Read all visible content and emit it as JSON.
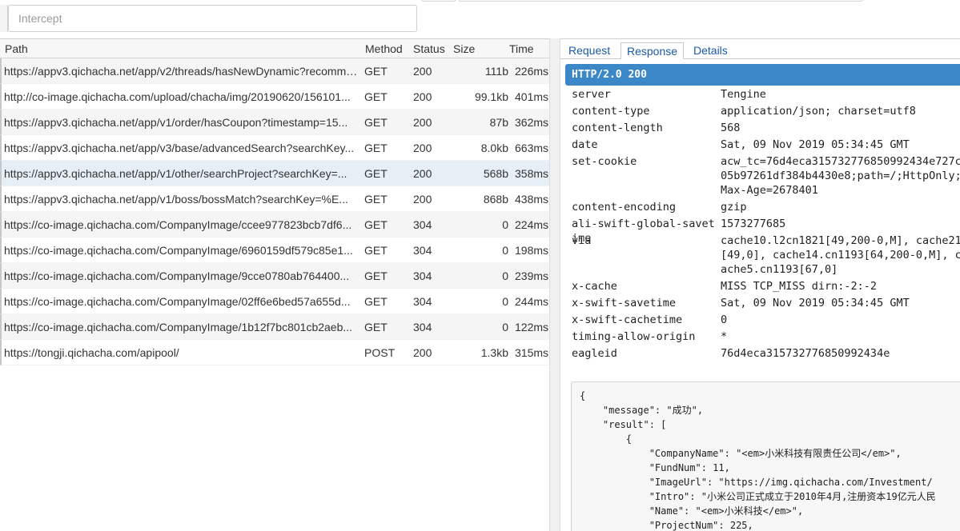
{
  "search": {
    "placeholder": "Intercept"
  },
  "table": {
    "headers": {
      "path": "Path",
      "method": "Method",
      "status": "Status",
      "size": "Size",
      "time": "Time"
    },
    "rows": [
      {
        "path": "https://appv3.qichacha.net/app/v2/threads/hasNewDynamic?recommend...",
        "method": "GET",
        "status": "200",
        "size": "111b",
        "time": "226ms"
      },
      {
        "path": "http://co-image.qichacha.com/upload/chacha/img/20190620/156101...",
        "method": "GET",
        "status": "200",
        "size": "99.1kb",
        "time": "401ms"
      },
      {
        "path": "https://appv3.qichacha.net/app/v1/order/hasCoupon?timestamp=15...",
        "method": "GET",
        "status": "200",
        "size": "87b",
        "time": "362ms"
      },
      {
        "path": "https://appv3.qichacha.net/app/v3/base/advancedSearch?searchKey...",
        "method": "GET",
        "status": "200",
        "size": "8.0kb",
        "time": "663ms"
      },
      {
        "path": "https://appv3.qichacha.net/app/v1/other/searchProject?searchKey=...",
        "method": "GET",
        "status": "200",
        "size": "568b",
        "time": "358ms"
      },
      {
        "path": "https://appv3.qichacha.net/app/v1/boss/bossMatch?searchKey=%E...",
        "method": "GET",
        "status": "200",
        "size": "868b",
        "time": "438ms"
      },
      {
        "path": "https://co-image.qichacha.com/CompanyImage/ccee977823bcb7df6...",
        "method": "GET",
        "status": "304",
        "size": "0",
        "time": "224ms"
      },
      {
        "path": "https://co-image.qichacha.com/CompanyImage/6960159df579c85e1...",
        "method": "GET",
        "status": "304",
        "size": "0",
        "time": "198ms"
      },
      {
        "path": "https://co-image.qichacha.com/CompanyImage/9cce0780ab764400...",
        "method": "GET",
        "status": "304",
        "size": "0",
        "time": "239ms"
      },
      {
        "path": "https://co-image.qichacha.com/CompanyImage/02ff6e6bed57a655d...",
        "method": "GET",
        "status": "304",
        "size": "0",
        "time": "244ms"
      },
      {
        "path": "https://co-image.qichacha.com/CompanyImage/1b12f7bc801cb2aeb...",
        "method": "GET",
        "status": "304",
        "size": "0",
        "time": "122ms"
      },
      {
        "path": "https://tongji.qichacha.com/apipool/",
        "method": "POST",
        "status": "200",
        "size": "1.3kb",
        "time": "315ms"
      }
    ],
    "selected_index": 4
  },
  "detail": {
    "tabs": [
      {
        "label": "Request"
      },
      {
        "label": "Response"
      },
      {
        "label": "Details"
      }
    ],
    "active_tab": "Response",
    "status_line": "HTTP/2.0 200",
    "headers": [
      {
        "key": "server",
        "value": "Tengine"
      },
      {
        "key": "content-type",
        "value": "application/json; charset=utf8"
      },
      {
        "key": "content-length",
        "value": "568"
      },
      {
        "key": "date",
        "value": "Sat, 09 Nov 2019 05:34:45 GMT"
      },
      {
        "key": "set-cookie",
        "value": "acw_tc=76d4eca315732776850992434e727c05b97261df384b4430e8;path=/;HttpOnly;Max-Age=2678401"
      },
      {
        "key": "content-encoding",
        "value": "gzip"
      },
      {
        "key": "ali-swift-global-savetime",
        "value": "1573277685"
      },
      {
        "key": "via",
        "value": "cache10.l2cn1821[49,200-0,M], cache21[49,0], cache14.cn1193[64,200-0,M], cache5.cn1193[67,0]"
      },
      {
        "key": "x-cache",
        "value": "MISS TCP_MISS dirn:-2:-2"
      },
      {
        "key": "x-swift-savetime",
        "value": "Sat, 09 Nov 2019 05:34:45 GMT"
      },
      {
        "key": "x-swift-cachetime",
        "value": "0"
      },
      {
        "key": "timing-allow-origin",
        "value": "*"
      },
      {
        "key": "eagleid",
        "value": "76d4eca315732776850992434e"
      }
    ],
    "body": "{\n    \"message\": \"成功\",\n    \"result\": [\n        {\n            \"CompanyName\": \"<em>小米科技有限责任公司</em>\",\n            \"FundNum\": 11,\n            \"ImageUrl\": \"https://img.qichacha.com/Investment/\n            \"Intro\": \"小米公司正式成立于2010年4月,注册资本19亿元人民\n            \"Name\": \"<em>小米科技</em>\",\n            \"ProjectNum\": 225,"
  }
}
